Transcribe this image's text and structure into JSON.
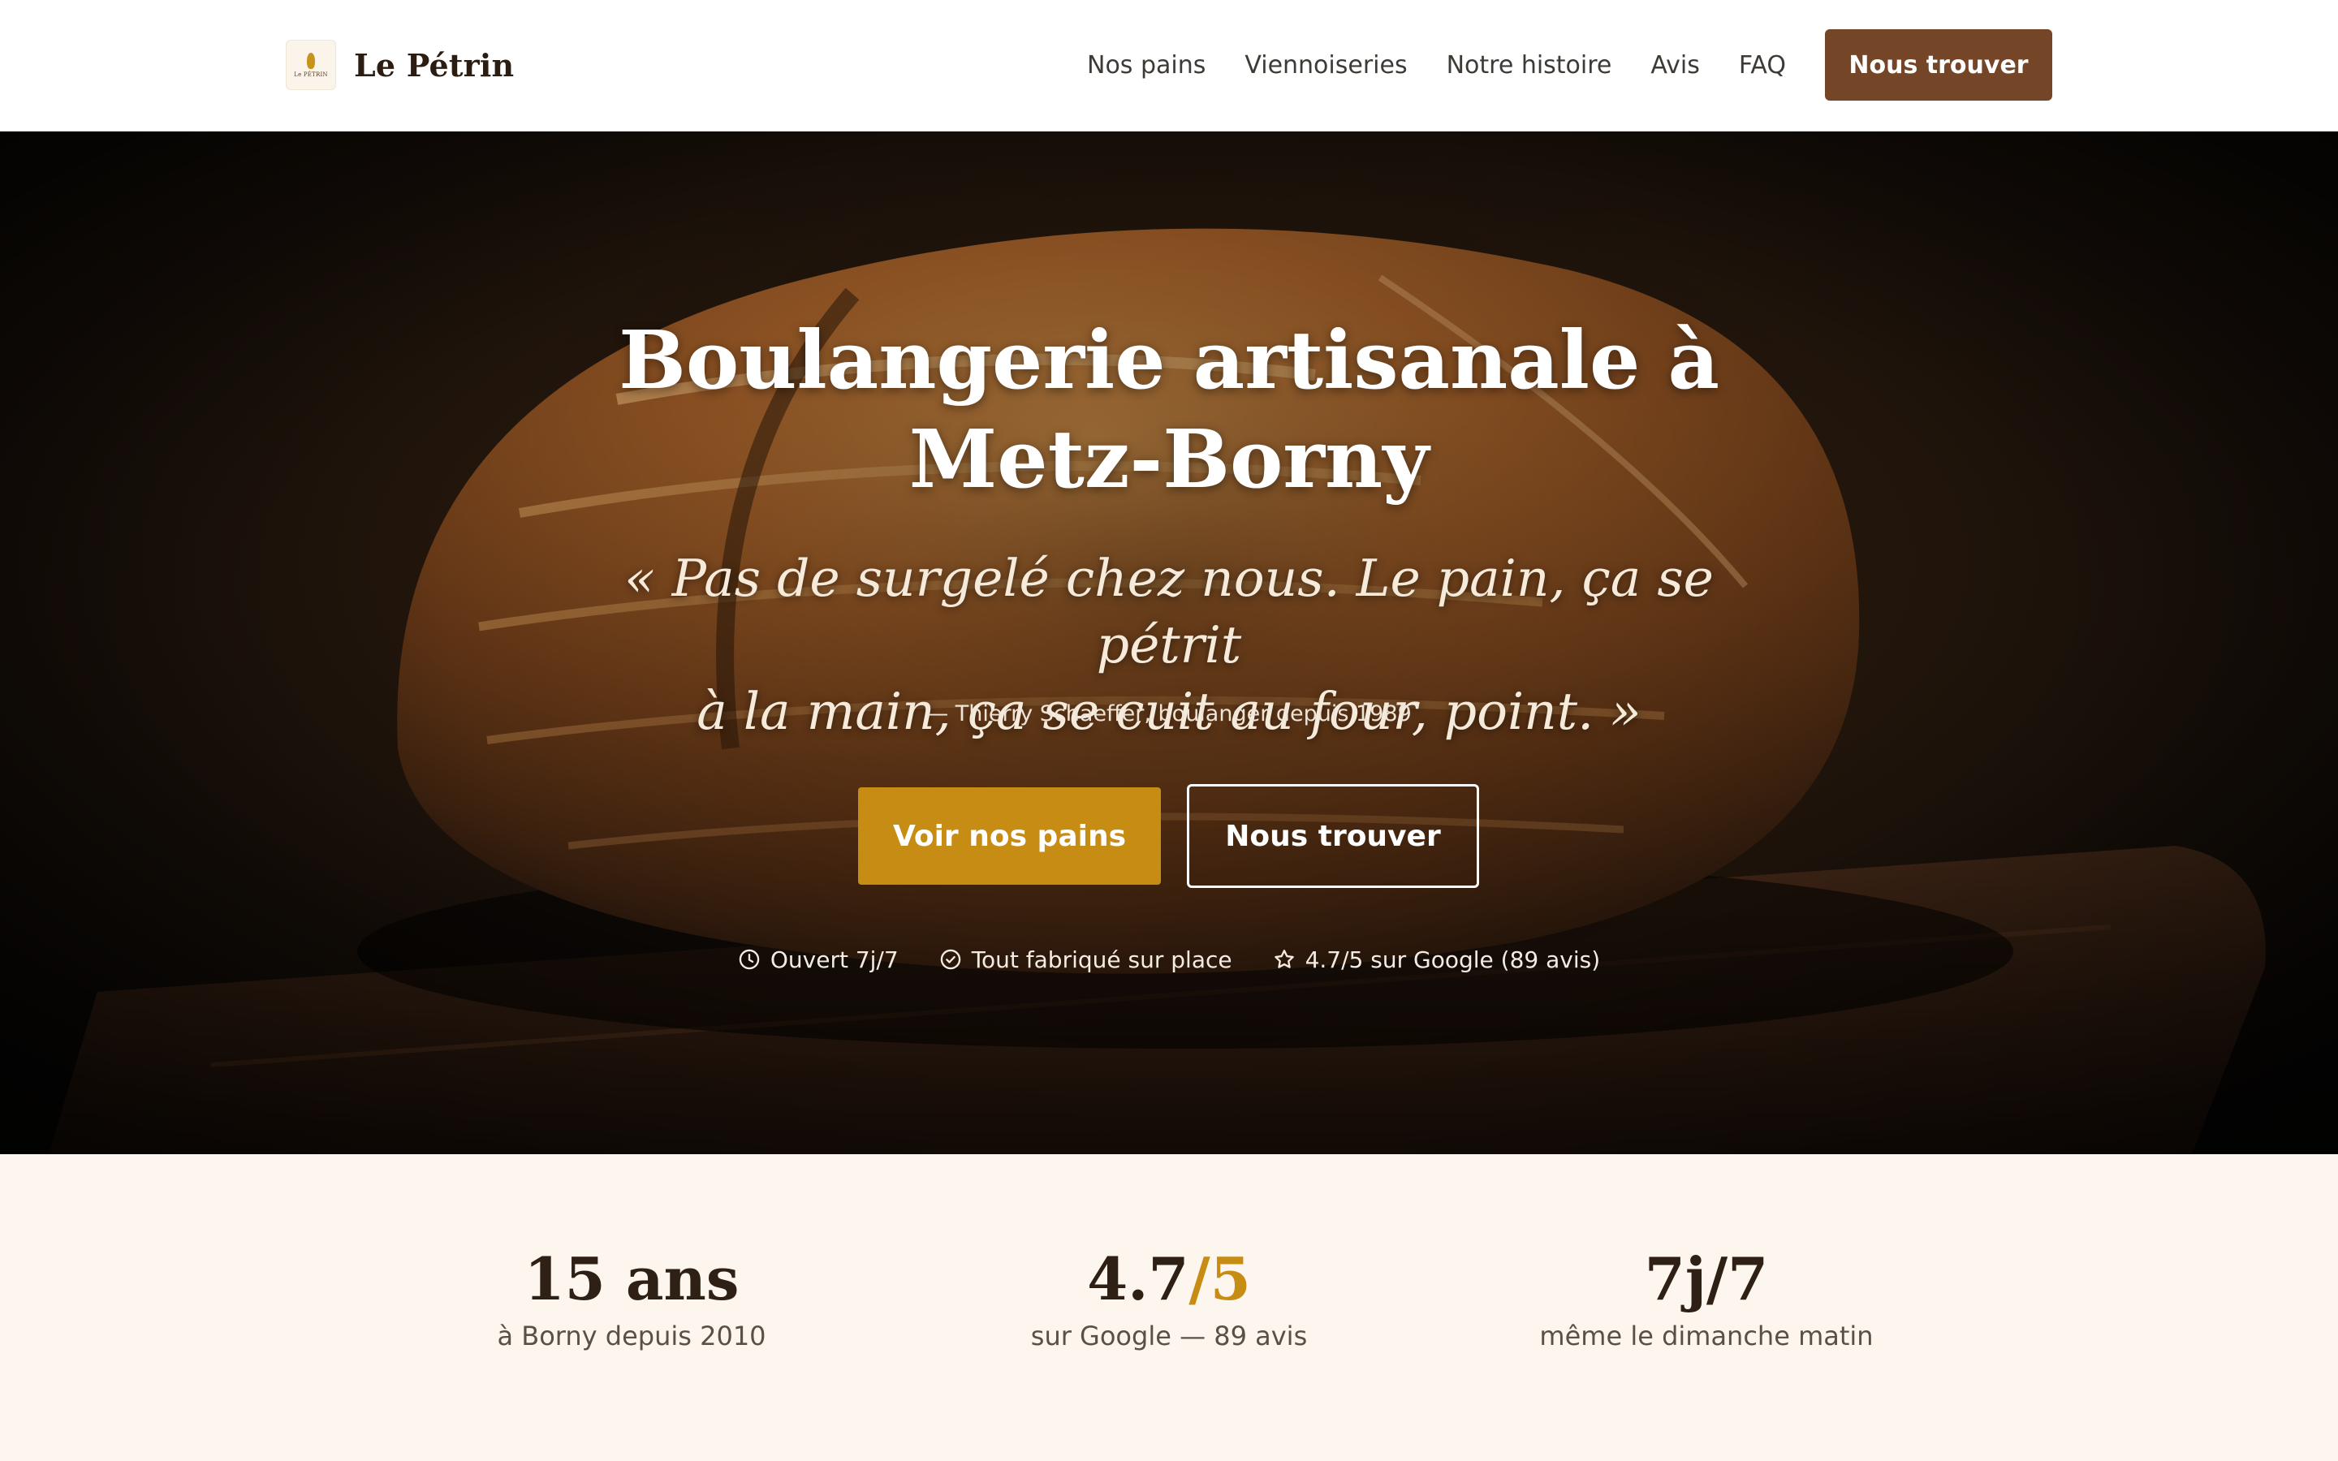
{
  "brand": {
    "logo_text": "Le PÉTRIN",
    "name": "Le Pétrin"
  },
  "nav": {
    "links": [
      "Nos pains",
      "Viennoiseries",
      "Notre histoire",
      "Avis",
      "FAQ"
    ],
    "cta": "Nous trouver"
  },
  "hero": {
    "title_line1": "Boulangerie artisanale à",
    "title_line2": "Metz-Borny",
    "quote_line1": "« Pas de surgelé chez nous. Le pain, ça se pétrit",
    "quote_line2": "à la main, ça se cuit au four, point. »",
    "author": "— Thierry Schaeffer, boulanger depuis 1989",
    "primary_button": "Voir nos pains",
    "secondary_button": "Nous trouver",
    "badges": [
      {
        "icon": "clock-icon",
        "label": "Ouvert 7j/7"
      },
      {
        "icon": "check-circle-icon",
        "label": "Tout fabriqué sur place"
      },
      {
        "icon": "star-icon",
        "label": "4.7/5 sur Google (89 avis)"
      }
    ]
  },
  "stats": [
    {
      "value": "15 ans",
      "label": "à Borny depuis 2010"
    },
    {
      "value_main": "4.7",
      "value_accent": "/5",
      "label": "sur Google — 89 avis"
    },
    {
      "value": "7j/7",
      "label": "même le dimanche matin"
    }
  ],
  "colors": {
    "brand_brown": "#744527",
    "accent_gold": "#c68c14",
    "stats_background": "#fdf6ef",
    "text_dark": "#2e2015"
  }
}
